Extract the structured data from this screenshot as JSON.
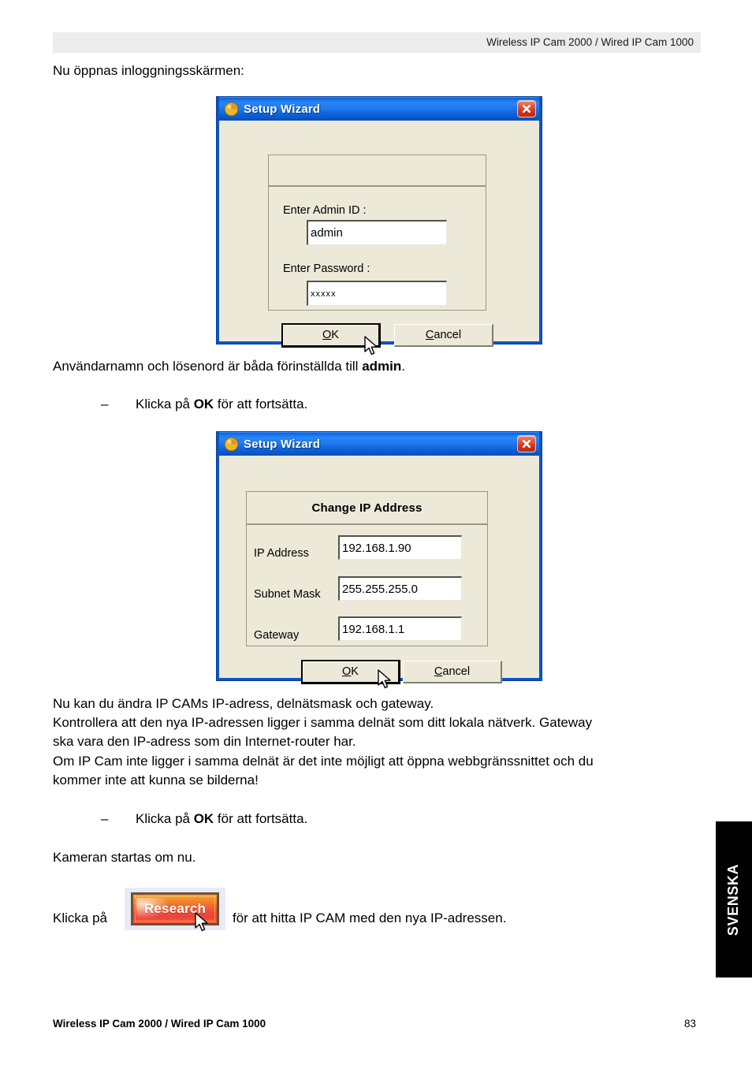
{
  "header": {
    "running_head": "Wireless IP Cam 2000 / Wired IP Cam 1000"
  },
  "intro": {
    "line": "Nu öppnas inloggningsskärmen:"
  },
  "login_dialog": {
    "title": "Setup Wizard",
    "icon": "setup-wizard-icon",
    "close_icon": "close-icon",
    "header_panel_text": "",
    "fields": [
      {
        "label": "Enter Admin ID :",
        "value": "admin",
        "type": "text"
      },
      {
        "label": "Enter Password :",
        "value": "xxxxx",
        "type": "password"
      }
    ],
    "buttons": {
      "ok": "OK",
      "ok_accel": "O",
      "cancel": "Cancel",
      "cancel_accel": "C"
    }
  },
  "after_login_text": {
    "sentence_prefix": "Användarnamn och lösenord är båda förinställda till ",
    "sentence_bold": "admin",
    "sentence_suffix": ".",
    "bullet_dash": "–",
    "bullet_prefix": "Klicka på ",
    "bullet_bold": "OK",
    "bullet_suffix": " för att fortsätta."
  },
  "ip_dialog": {
    "title": "Setup Wizard",
    "icon": "setup-wizard-icon",
    "close_icon": "close-icon",
    "header_panel_text": "Change IP Address",
    "fields": [
      {
        "label": "IP Address",
        "value": "192.168.1.90"
      },
      {
        "label": "Subnet Mask",
        "value": "255.255.255.0"
      },
      {
        "label": "Gateway",
        "value": "192.168.1.1"
      }
    ],
    "buttons": {
      "ok": "OK",
      "ok_accel": "O",
      "cancel": "Cancel",
      "cancel_accel": "C"
    }
  },
  "explanation": {
    "line1": "Nu kan du ändra IP CAMs IP-adress, delnätsmask och gateway.",
    "line2": "Kontrollera att den nya IP-adressen ligger i samma delnät som ditt lokala nätverk. Gateway",
    "line3": "ska vara den IP-adress som din Internet-router har.",
    "line4": "Om IP Cam inte ligger i samma delnät är det inte möjligt att öppna webbgränssnittet och du",
    "line5": "kommer inte att kunna se bilderna!"
  },
  "after_ip_text": {
    "bullet_dash": "–",
    "bullet_prefix": "Klicka på ",
    "bullet_bold": "OK",
    "bullet_suffix": " för att fortsätta.",
    "restart_line": "Kameran startas om nu."
  },
  "research_step": {
    "prefix": "Klicka på",
    "button_label": "Research",
    "suffix": "för att hitta IP CAM med den nya IP-adressen."
  },
  "side_tab": {
    "label": "SVENSKA",
    "background": "#000000",
    "text_color": "#ffffff"
  },
  "footer": {
    "left": "Wireless IP Cam 2000 / Wired IP Cam 1000",
    "page_number": "83"
  },
  "colors": {
    "titlebar_blue": "#1572ef",
    "dialog_face": "#ece9d8",
    "close_red": "#cc3019",
    "header_band": "#ececec",
    "research_orange": "#f4902f",
    "research_red": "#ee4338"
  }
}
